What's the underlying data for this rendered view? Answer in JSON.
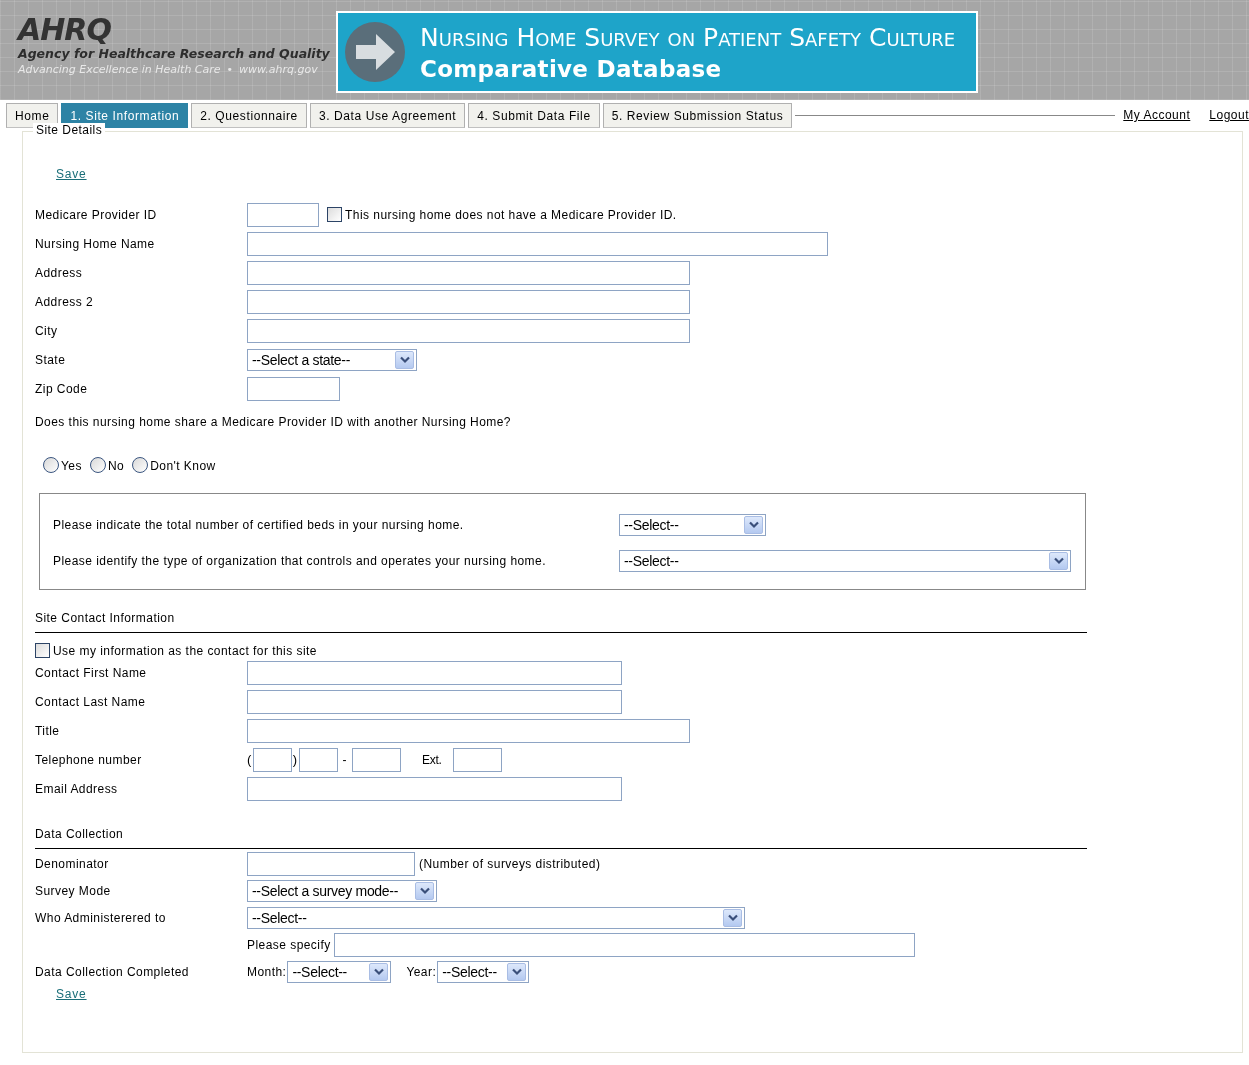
{
  "header": {
    "logo": "AHRQ",
    "agency": "Agency for Healthcare Research and Quality",
    "tagline": "Advancing Excellence in Health Care",
    "separator": "•",
    "website": "www.ahrq.gov",
    "banner_title": "Nursing Home Survey on Patient Safety Culture",
    "banner_subtitle": "Comparative Database"
  },
  "tabs": [
    {
      "label": "Home",
      "selected": false
    },
    {
      "label": "1. Site Information",
      "selected": true
    },
    {
      "label": "2. Questionnaire",
      "selected": false
    },
    {
      "label": "3. Data Use Agreement",
      "selected": false
    },
    {
      "label": "4. Submit Data File",
      "selected": false
    },
    {
      "label": "5. Review Submission Status",
      "selected": false
    }
  ],
  "account_links": [
    "My Account",
    "Logout"
  ],
  "site_details": {
    "legend": "Site Details",
    "save_top": "Save",
    "fields": [
      {
        "label": "Medicare Provider ID",
        "kind": "input",
        "option": {
          "label": "This nursing home does not have a Medicare Provider ID.",
          "checked": false
        }
      },
      {
        "label": "Nursing Home Name",
        "kind": "input"
      },
      {
        "label": "Address",
        "kind": "input"
      },
      {
        "label": "Address 2",
        "kind": "input"
      },
      {
        "label": "City",
        "kind": "input"
      },
      {
        "label": "State",
        "kind": "select",
        "value": "--Select a state--"
      },
      {
        "label": "Zip Code",
        "kind": "input"
      }
    ],
    "shared_question": "Does this nursing home share a Medicare Provider ID with another Nursing Home?",
    "shared_options": [
      {
        "label": "Yes",
        "selected": false
      },
      {
        "label": "No",
        "selected": false
      },
      {
        "label": "Don't Know",
        "selected": false
      }
    ],
    "facility_questions": [
      {
        "label": "Please indicate the total number of certified beds in your nursing home.",
        "value": "--Select--"
      },
      {
        "label": "Please identify the type of organization that controls and operates your nursing home.",
        "value": "--Select--"
      }
    ],
    "contact": {
      "heading": "Site Contact Information",
      "use_mine": {
        "label": "Use my information as the contact for this site",
        "checked": false
      },
      "fields": [
        {
          "label": "Contact First Name",
          "kind": "input"
        },
        {
          "label": "Contact Last Name",
          "kind": "input"
        },
        {
          "label": "Title",
          "kind": "input"
        },
        {
          "label": "Telephone number",
          "kind": "phone",
          "parts": [
            "(",
            ")",
            "-",
            "Ext."
          ]
        },
        {
          "label": "Email Address",
          "kind": "input"
        }
      ]
    },
    "data_collection": {
      "heading": "Data Collection",
      "fields": [
        {
          "label": "Denominator",
          "kind": "input",
          "note": "(Number of surveys distributed)"
        },
        {
          "label": "Survey Mode",
          "kind": "select",
          "value": "--Select a survey mode--"
        },
        {
          "label": "Who Administerered to",
          "kind": "select",
          "value": "--Select--"
        },
        {
          "kind": "specify",
          "label": "Please specify"
        },
        {
          "label": "Data Collection Completed",
          "kind": "date",
          "month": {
            "label": "Month:",
            "value": "--Select--"
          },
          "year": {
            "label": "Year:",
            "value": "--Select--"
          }
        }
      ]
    },
    "save_bottom": "Save"
  }
}
